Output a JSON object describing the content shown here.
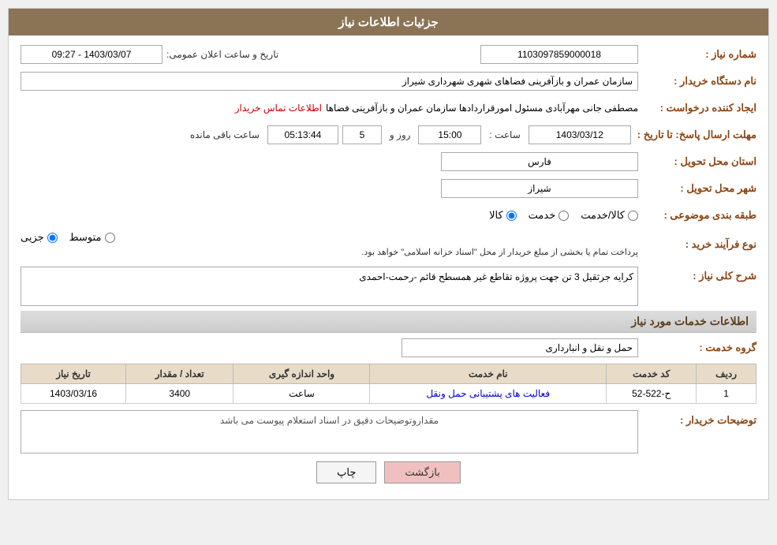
{
  "page": {
    "title": "جزئیات اطلاعات نیاز"
  },
  "header": {
    "title": "جزئیات اطلاعات نیاز"
  },
  "fields": {
    "shomara_niaz_label": "شماره نیاز :",
    "shomara_niaz_value": "1103097859000018",
    "nam_dastgah_label": "نام دستگاه خریدار :",
    "nam_dastgah_value": "سازمان عمران و بازآفرینی فضاهای شهری شهرداری شیراز",
    "ijad_konande_label": "ایجاد کننده درخواست :",
    "ijad_konande_value": "مصطفی جانی مهرآبادی مسئول امورقراردادها سازمان عمران و بازآفرینی فضاها",
    "contact_link": "اطلاعات تماس خریدار",
    "mohlat_label": "مهلت ارسال پاسخ: تا تاریخ :",
    "date_value": "1403/03/12",
    "time_label": "ساعت :",
    "time_value": "15:00",
    "roz_label": "روز و",
    "roz_value": "5",
    "remaining_label": "ساعت باقی مانده",
    "remaining_value": "05:13:44",
    "ostan_label": "استان محل تحویل :",
    "ostan_value": "فارس",
    "shahr_label": "شهر محل تحویل :",
    "shahr_value": "شیراز",
    "tabaqe_label": "طبقه بندی موضوعی :",
    "radio_kala": "کالا",
    "radio_khadamat": "خدمت",
    "radio_kala_khadamat": "کالا/خدمت",
    "noeFarayand_label": "نوع فرآیند خرید :",
    "radio_jozii": "جزیی",
    "radio_motavaset": "متوسط",
    "noeFarayand_desc": "پرداخت تمام یا بخشی از مبلغ خریدار از محل \"اسناد خزانه اسلامی\" خواهد بود.",
    "sharh_label": "شرح کلی نیاز :",
    "sharh_value": "کرایه جرثقیل 3 تن جهت پروژه تقاطع غیر همسطح قائم -رحمت-احمدی",
    "services_header": "اطلاعات خدمات مورد نیاز",
    "group_service_label": "گروه خدمت :",
    "group_service_value": "حمل و نقل و انبارداری",
    "table": {
      "headers": [
        "ردیف",
        "کد خدمت",
        "نام خدمت",
        "واحد اندازه گیری",
        "تعداد / مقدار",
        "تاریخ نیاز"
      ],
      "rows": [
        {
          "radif": "1",
          "kod": "ح-522-52",
          "name": "فعالیت های پشتیبانی حمل ونقل",
          "vahed": "ساعت",
          "tedad": "3400",
          "tarikh": "1403/03/16"
        }
      ]
    },
    "buyer_notes_label": "توضیحات خریدار :",
    "buyer_notes_value": "مقداروتوضیحات دقیق در اسناد استعلام پیوست می باشد",
    "btn_print": "چاپ",
    "btn_back": "بازگشت",
    "tarikh_saatLabel": "تاریخ و ساعت اعلان عمومی:",
    "tarikh_saatValue": "1403/03/07 - 09:27"
  }
}
